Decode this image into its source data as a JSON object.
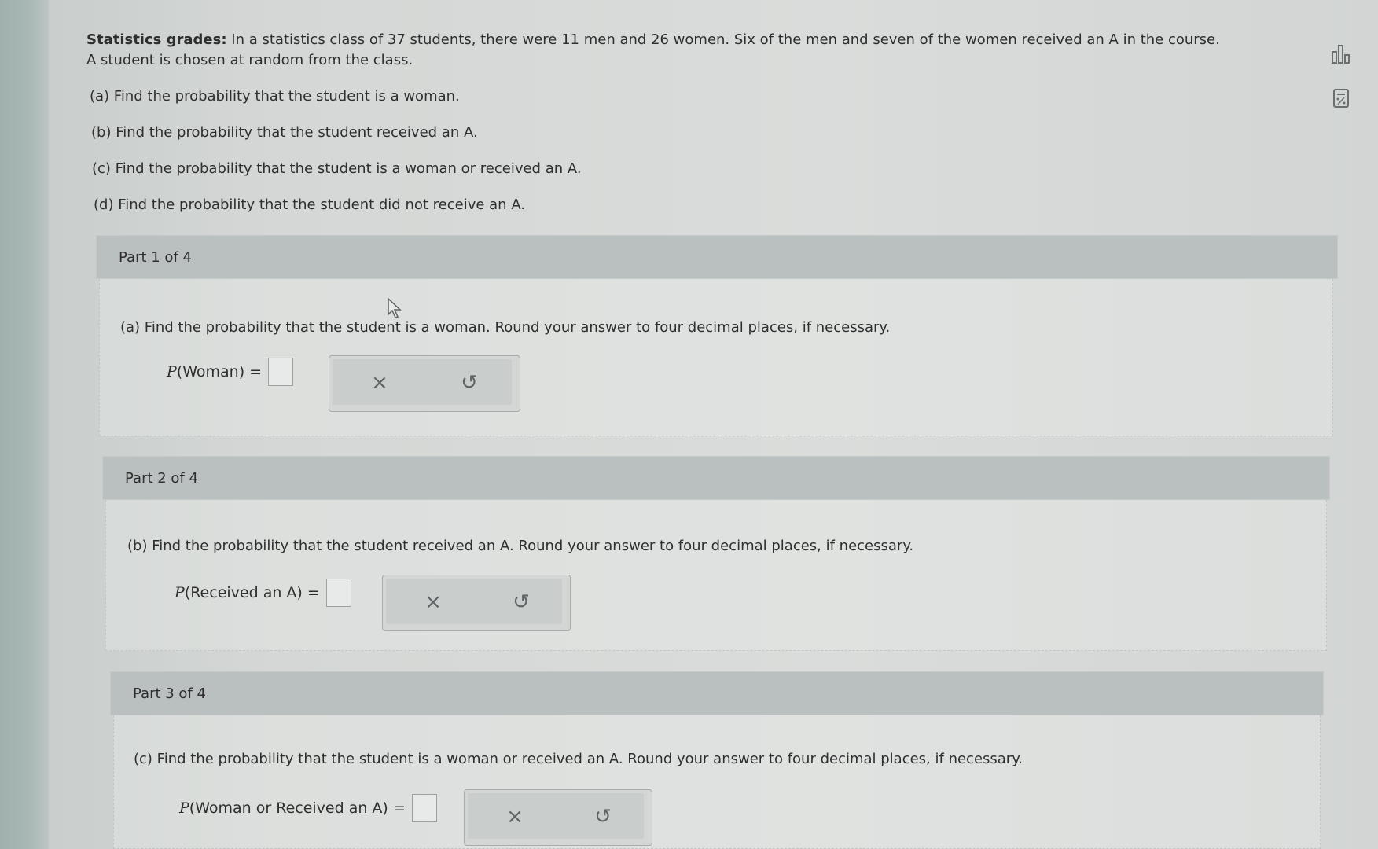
{
  "problem": {
    "title": "Statistics grades:",
    "text": "In a statistics class of 37 students, there were 11 men and 26 women. Six of the men and seven of the women received an A in the course.",
    "text2": "A student is chosen at random from the class.",
    "questions": [
      "(a) Find the probability that the student is a woman.",
      "(b) Find the probability that the student received an A.",
      "(c) Find the probability that the student is a woman or received an A.",
      "(d) Find the probability that the student did not receive an A."
    ]
  },
  "side_icons": [
    "bar-chart-icon",
    "calculator-icon"
  ],
  "parts": [
    {
      "header": "Part 1 of 4",
      "prompt": "(a) Find the probability that the student is a woman. Round your answer to four decimal places, if necessary.",
      "label_p": "P",
      "label_rest": "(Woman) =",
      "answer_value": "",
      "clear_icon": "×",
      "undo_icon": "↺"
    },
    {
      "header": "Part 2 of 4",
      "prompt": "(b) Find the probability that the student received an A. Round your answer to four decimal places, if necessary.",
      "label_p": "P",
      "label_rest": "(Received an A) =",
      "answer_value": "",
      "clear_icon": "×",
      "undo_icon": "↺"
    },
    {
      "header": "Part 3 of 4",
      "prompt": "(c) Find the probability that the student is a woman or received an A. Round your answer to four decimal places, if necessary.",
      "label_p": "P",
      "label_rest": "(Woman or Received an A) =",
      "answer_value": "",
      "clear_icon": "×",
      "undo_icon": "↺"
    }
  ]
}
